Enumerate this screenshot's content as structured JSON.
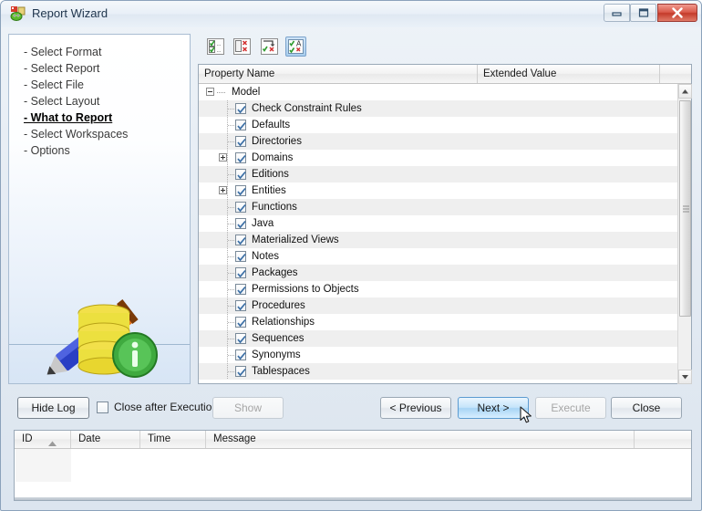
{
  "window": {
    "title": "Report Wizard",
    "icon": "report-wizard-icon",
    "controls": {
      "minimize": "minimize-icon",
      "maximize": "maximize-icon",
      "close": "close-icon"
    }
  },
  "sidebar": {
    "steps": [
      {
        "label": "- Select Format",
        "current": false
      },
      {
        "label": "- Select Report",
        "current": false
      },
      {
        "label": "- Select File",
        "current": false
      },
      {
        "label": "- Select Layout",
        "current": false
      },
      {
        "label": "- What to Report",
        "current": true
      },
      {
        "label": "- Select Workspaces",
        "current": false
      },
      {
        "label": "- Options",
        "current": false
      }
    ],
    "illustration": "pencil-database-info-illustration"
  },
  "toolbar": {
    "buttons": [
      {
        "name": "select-all-button",
        "icon": "checkmarks-icon"
      },
      {
        "name": "deselect-all-button",
        "icon": "red-x-marks-icon"
      },
      {
        "name": "invert-selection-button",
        "icon": "toggle-selection-icon"
      },
      {
        "name": "select-by-name-button",
        "icon": "check-letter-a-icon",
        "active": true
      }
    ]
  },
  "tree": {
    "columns": [
      "Property Name",
      "Extended Value",
      ""
    ],
    "root": {
      "label": "Model",
      "expanded": true,
      "expander": "minus"
    },
    "rows": [
      {
        "label": "Check Constraint Rules",
        "checked": true,
        "expandable": false
      },
      {
        "label": "Defaults",
        "checked": true,
        "expandable": false
      },
      {
        "label": "Directories",
        "checked": true,
        "expandable": false
      },
      {
        "label": "Domains",
        "checked": true,
        "expandable": true
      },
      {
        "label": "Editions",
        "checked": true,
        "expandable": false
      },
      {
        "label": "Entities",
        "checked": true,
        "expandable": true
      },
      {
        "label": "Functions",
        "checked": true,
        "expandable": false
      },
      {
        "label": "Java",
        "checked": true,
        "expandable": false
      },
      {
        "label": "Materialized Views",
        "checked": true,
        "expandable": false
      },
      {
        "label": "Notes",
        "checked": true,
        "expandable": false
      },
      {
        "label": "Packages",
        "checked": true,
        "expandable": false
      },
      {
        "label": "Permissions to Objects",
        "checked": true,
        "expandable": false
      },
      {
        "label": "Procedures",
        "checked": true,
        "expandable": false
      },
      {
        "label": "Relationships",
        "checked": true,
        "expandable": false
      },
      {
        "label": "Sequences",
        "checked": true,
        "expandable": false
      },
      {
        "label": "Synonyms",
        "checked": true,
        "expandable": false
      },
      {
        "label": "Tablespaces",
        "checked": true,
        "expandable": false
      }
    ]
  },
  "actions": {
    "hide_log": "Hide Log",
    "close_after_execution": "Close after Execution",
    "close_after_execution_checked": false,
    "show": "Show",
    "show_enabled": false,
    "previous": "< Previous",
    "next": "Next >",
    "next_highlighted": true,
    "execute": "Execute",
    "execute_enabled": false,
    "close": "Close"
  },
  "log": {
    "columns": [
      "ID",
      "Date",
      "Time",
      "Message",
      ""
    ],
    "sort_column": "ID",
    "sort_direction": "ascending",
    "rows": []
  },
  "colors": {
    "accent": "#a7d4f5",
    "close_button": "#c43a2a",
    "check": "#3a6ea5",
    "sidebar_bottom": "#d7e5f5"
  }
}
